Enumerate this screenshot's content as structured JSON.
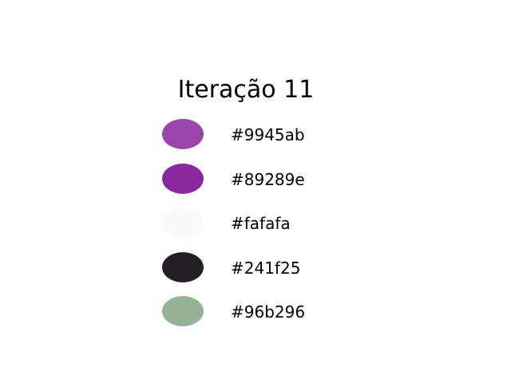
{
  "title": "Iteração 11",
  "swatches": [
    {
      "color": "#9945ab",
      "label": "#9945ab"
    },
    {
      "color": "#89289e",
      "label": "#89289e"
    },
    {
      "color": "#fafafa",
      "label": "#fafafa"
    },
    {
      "color": "#241f25",
      "label": "#241f25"
    },
    {
      "color": "#96b296",
      "label": "#96b296"
    }
  ]
}
